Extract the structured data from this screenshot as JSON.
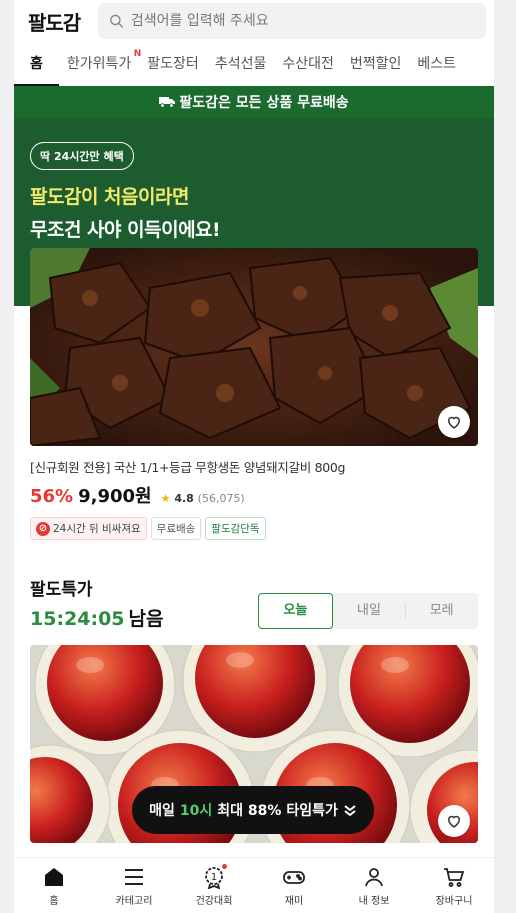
{
  "header": {
    "logo": "팔도감",
    "search_placeholder": "검색어를 입력해 주세요"
  },
  "tabs": [
    {
      "label": "홈",
      "active": true
    },
    {
      "label": "한가위특가",
      "badge": "N"
    },
    {
      "label": "팔도장터"
    },
    {
      "label": "추석선물"
    },
    {
      "label": "수산대전"
    },
    {
      "label": "번쩍할인"
    },
    {
      "label": "베스트"
    }
  ],
  "banner": {
    "text": "팔도감은 모든 상품 무료배송"
  },
  "hero": {
    "pill": "딱 24시간만 혜택",
    "line1": "팔도감이 처음이라면",
    "line2": "무조건 사야 이득이에요!"
  },
  "product": {
    "name": "[신규회원 전용] 국산 1/1+등급 무항생돈 양념돼지갈비 800g",
    "discount": "56%",
    "price": "9,900원",
    "rating": "4.8",
    "review_count": "(56,075)",
    "tags": [
      "24시간 뒤 비싸져요",
      "무료배송",
      "팔도감단독"
    ]
  },
  "special": {
    "title": "팔도특가",
    "timer": "15:24:05",
    "timer_suffix": "남음",
    "day_tabs": [
      "오늘",
      "내일",
      "모레"
    ]
  },
  "floating_banner": {
    "prefix": "매일",
    "highlight": "10시",
    "suffix": "최대 88% 타임특가"
  },
  "bottom_nav": [
    "홈",
    "카테고리",
    "건강대회",
    "재미",
    "내 정보",
    "장바구니"
  ],
  "colors": {
    "brand_green": "#1c5c2e",
    "accent_green": "#2a8c3e",
    "sale_red": "#e53935",
    "hero_yellow": "#f4e96b"
  }
}
